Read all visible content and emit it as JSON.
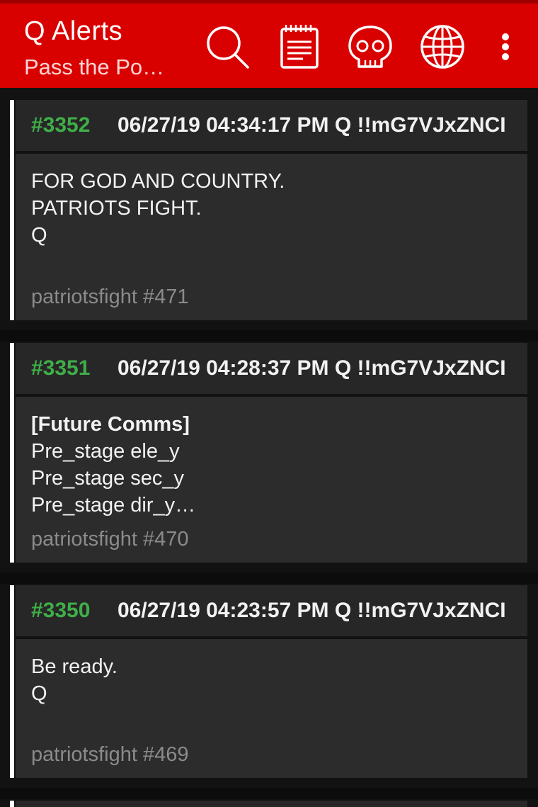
{
  "appbar": {
    "title": "Q Alerts",
    "subtitle": "Pass the Po…",
    "icons": [
      "search-icon",
      "notepad-icon",
      "skull-icon",
      "globe-icon",
      "overflow-menu-icon"
    ],
    "accent_color": "#d90000"
  },
  "posts": [
    {
      "number": "#3352",
      "meta": "06/27/19 04:34:17 PM Q !!mG7VJxZNCI",
      "heading": "",
      "lines": [
        "FOR GOD AND COUNTRY.",
        "PATRIOTS FIGHT.",
        "Q"
      ],
      "source": "patriotsfight #471"
    },
    {
      "number": "#3351",
      "meta": "06/27/19 04:28:37 PM Q !!mG7VJxZNCI",
      "heading": "[Future Comms]",
      "lines": [
        "Pre_stage ele_y",
        "Pre_stage sec_y",
        "Pre_stage dir_y…"
      ],
      "source": "patriotsfight #470"
    },
    {
      "number": "#3350",
      "meta": "06/27/19 04:23:57 PM Q !!mG7VJxZNCI",
      "heading": "",
      "lines": [
        "Be ready.",
        "Q"
      ],
      "source": "patriotsfight #469"
    }
  ],
  "colors": {
    "post_number": "#3fae49",
    "background": "#121212",
    "card": "#2c2c2c"
  }
}
